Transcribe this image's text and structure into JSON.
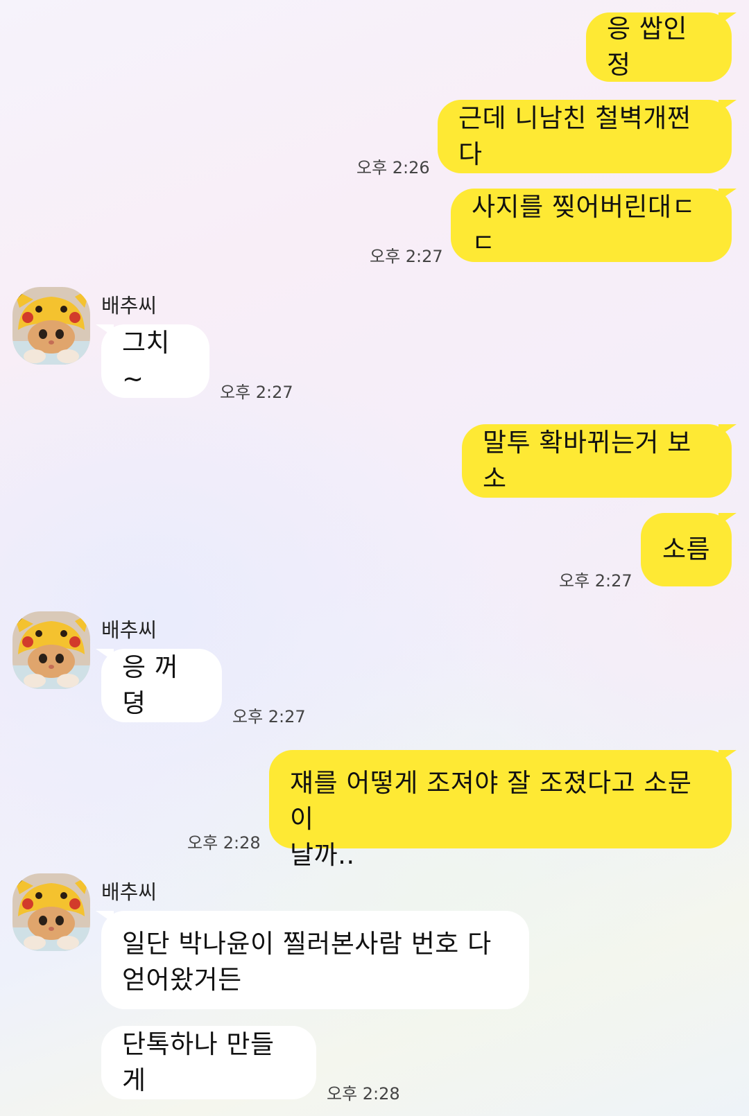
{
  "contact": {
    "name": "배추씨"
  },
  "messages": [
    {
      "from": "me",
      "text": "응 쌉인정",
      "time": ""
    },
    {
      "from": "me",
      "text": "근데 니남친 철벽개쩐다",
      "time": "오후 2:26"
    },
    {
      "from": "me",
      "text": "사지를 찢어버린대ㄷㄷ",
      "time": "오후 2:27"
    },
    {
      "from": "other",
      "text": "그치~",
      "time": "오후 2:27"
    },
    {
      "from": "me",
      "text": "말투 확바뀌는거 보소",
      "time": ""
    },
    {
      "from": "me",
      "text": "소름",
      "time": "오후 2:27"
    },
    {
      "from": "other",
      "text": "응 꺼뎡",
      "time": "오후 2:27"
    },
    {
      "from": "me",
      "text_lines": [
        "쟤를 어떻게 조져야 잘 조졌다고 소문이",
        "날까.."
      ],
      "time": "오후 2:28"
    },
    {
      "from": "other",
      "text_lines": [
        "일단 박나윤이 찔러본사람 번호 다",
        "얻어왔거든"
      ],
      "time": ""
    },
    {
      "from": "other",
      "text": "단톡하나 만들게",
      "time": "오후 2:28"
    }
  ],
  "colors": {
    "my_bubble": "#fee934",
    "other_bubble": "#ffffff"
  },
  "icons": {
    "avatar": "pikachu-hat-cat-avatar"
  }
}
